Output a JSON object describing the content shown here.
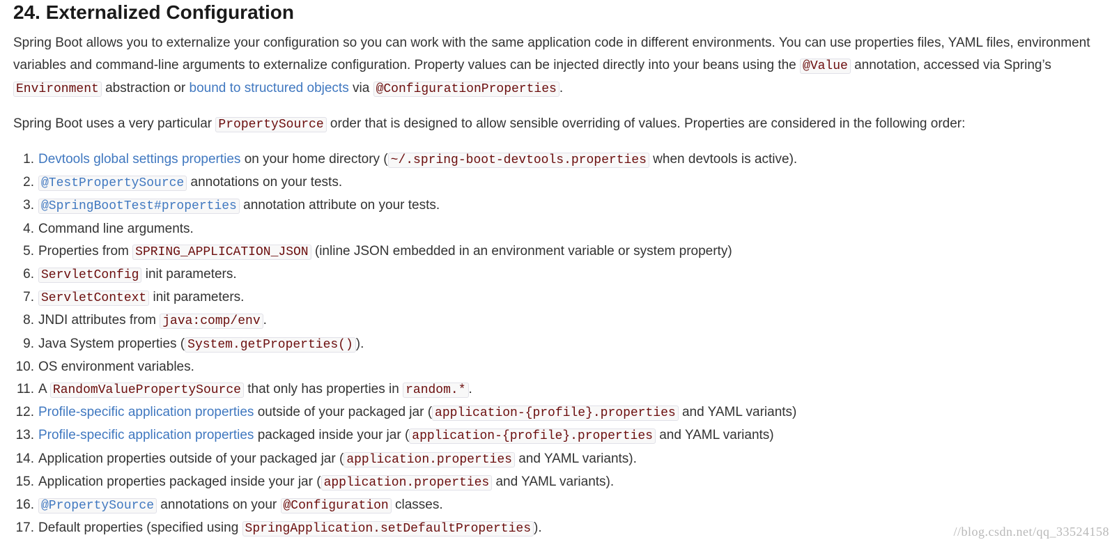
{
  "heading": "24. Externalized Configuration",
  "intro": {
    "t1": "Spring Boot allows you to externalize your configuration so you can work with the same application code in different environments. You can use properties files, YAML files, environment variables and command-line arguments to externalize configuration. Property values can be injected directly into your beans using the ",
    "c1": "@Value",
    "t2": " annotation, accessed via Spring’s ",
    "c2": "Environment",
    "t3": " abstraction or ",
    "link": "bound to structured objects",
    "t4": " via ",
    "c3": "@ConfigurationProperties",
    "t5": "."
  },
  "order_para": {
    "t1": "Spring Boot uses a very particular ",
    "c1": "PropertySource",
    "t2": " order that is designed to allow sensible overriding of values. Properties are considered in the following order:"
  },
  "items": [
    {
      "num": "1.",
      "link": "Devtools global settings properties",
      "t1": " on your home directory (",
      "c1": "~/.spring-boot-devtools.properties",
      "t2": " when devtools is active)."
    },
    {
      "num": "2.",
      "linkcode": "@TestPropertySource",
      "t1": " annotations on your tests."
    },
    {
      "num": "3.",
      "linkcode": "@SpringBootTest#properties",
      "t1": " annotation attribute on your tests."
    },
    {
      "num": "4.",
      "t1": "Command line arguments."
    },
    {
      "num": "5.",
      "t1": "Properties from ",
      "c1": "SPRING_APPLICATION_JSON",
      "t2": " (inline JSON embedded in an environment variable or system property)"
    },
    {
      "num": "6.",
      "c0": "ServletConfig",
      "t1": " init parameters."
    },
    {
      "num": "7.",
      "c0": "ServletContext",
      "t1": " init parameters."
    },
    {
      "num": "8.",
      "t1": "JNDI attributes from ",
      "c1": "java:comp/env",
      "t2": "."
    },
    {
      "num": "9.",
      "t1": "Java System properties (",
      "c1": "System.getProperties()",
      "t2": ")."
    },
    {
      "num": "10.",
      "t1": "OS environment variables."
    },
    {
      "num": "11.",
      "t1": "A ",
      "c1": "RandomValuePropertySource",
      "t2": " that only has properties in ",
      "c2": "random.*",
      "t3": "."
    },
    {
      "num": "12.",
      "link": "Profile-specific application properties",
      "t1": " outside of your packaged jar (",
      "c1": "application-{profile}.properties",
      "t2": " and YAML variants)"
    },
    {
      "num": "13.",
      "link": "Profile-specific application properties",
      "t1": " packaged inside your jar (",
      "c1": "application-{profile}.properties",
      "t2": " and YAML variants)"
    },
    {
      "num": "14.",
      "t1": "Application properties outside of your packaged jar (",
      "c1": "application.properties",
      "t2": " and YAML variants)."
    },
    {
      "num": "15.",
      "t1": "Application properties packaged inside your jar (",
      "c1": "application.properties",
      "t2": " and YAML variants)."
    },
    {
      "num": "16.",
      "linkcode": "@PropertySource",
      "t1": " annotations on your ",
      "c1": "@Configuration",
      "t2": " classes."
    },
    {
      "num": "17.",
      "t1": "Default properties (specified using ",
      "c1": "SpringApplication.setDefaultProperties",
      "t2": ")."
    }
  ],
  "watermark": "//blog.csdn.net/qq_33524158"
}
